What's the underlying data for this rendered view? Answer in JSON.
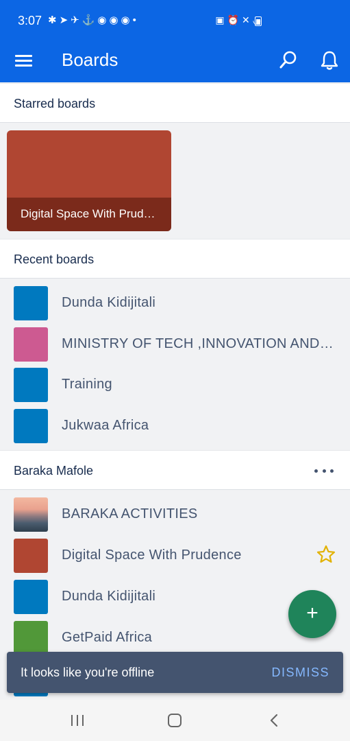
{
  "status_bar": {
    "time": "3:07"
  },
  "app_bar": {
    "title": "Boards"
  },
  "starred": {
    "header": "Starred boards",
    "cards": [
      {
        "title": "Digital Space With Prudence",
        "color": "#b04632"
      }
    ]
  },
  "recent": {
    "header": "Recent boards",
    "boards": [
      {
        "name": "Dunda Kidijitali",
        "color": "#0079bf"
      },
      {
        "name": "MINISTRY OF TECH ,INNOVATION AND COMMUNICATION",
        "color": "#cd5a91"
      },
      {
        "name": "Training",
        "color": "#0079bf"
      },
      {
        "name": "Jukwaa Africa",
        "color": "#0079bf"
      }
    ]
  },
  "workspace": {
    "header": "Baraka Mafole",
    "boards": [
      {
        "name": "BARAKA ACTIVITIES",
        "color": "photo",
        "starred": false
      },
      {
        "name": "Digital Space With Prudence",
        "color": "#b04632",
        "starred": true
      },
      {
        "name": "Dunda Kidijitali",
        "color": "#0079bf",
        "starred": false
      },
      {
        "name": "GetPaid Africa",
        "color": "#519839",
        "starred": false
      }
    ]
  },
  "snackbar": {
    "message": "It looks like you're offline",
    "action": "DISMISS"
  },
  "fab": {
    "label": "+"
  },
  "colors": {
    "primary": "#0c66e4",
    "fab": "#1f845a",
    "star": "#e2b203"
  }
}
